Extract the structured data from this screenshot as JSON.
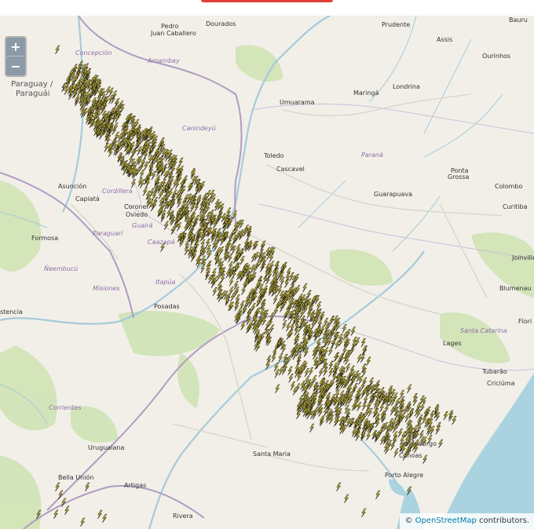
{
  "zoom": {
    "in_label": "+",
    "out_label": "−"
  },
  "attribution": {
    "prefix": "©",
    "link": "OpenStreetMap",
    "suffix": " contributors."
  },
  "colors": {
    "land": "#f2efe9",
    "water": "#aad3df",
    "forest": "#c8dfb0",
    "bolt": "#f5e33c",
    "bolt_outline": "#2d2a1a",
    "border": "#b09cc0"
  },
  "labels": [
    {
      "name": "label-pedro",
      "text": "Pedro",
      "cls": "city"
    },
    {
      "name": "label-dourados",
      "text": "Dourados",
      "cls": "city"
    },
    {
      "name": "label-juan-caballero",
      "text": "Juan Caballero",
      "cls": "city"
    },
    {
      "name": "label-prudente",
      "text": "Prudente",
      "cls": "city"
    },
    {
      "name": "label-bauru",
      "text": "Bauru",
      "cls": "city"
    },
    {
      "name": "label-concepcion",
      "text": "Concepción",
      "cls": "region"
    },
    {
      "name": "label-amambay",
      "text": "Amambay",
      "cls": "region"
    },
    {
      "name": "label-assis",
      "text": "Assis",
      "cls": "city"
    },
    {
      "name": "label-ourinhos",
      "text": "Ourinhos",
      "cls": "city"
    },
    {
      "name": "label-paraguay-1",
      "text": "Paraguay /",
      "cls": "country"
    },
    {
      "name": "label-paraguay-2",
      "text": "Paraguái",
      "cls": "country"
    },
    {
      "name": "label-maringa",
      "text": "Maringá",
      "cls": "city"
    },
    {
      "name": "label-londrina",
      "text": "Londrina",
      "cls": "city"
    },
    {
      "name": "label-umuarama",
      "text": "Umuarama",
      "cls": "city"
    },
    {
      "name": "label-canindeyu",
      "text": "Canindeyú",
      "cls": "region"
    },
    {
      "name": "label-toledo",
      "text": "Toledo",
      "cls": "city"
    },
    {
      "name": "label-parana",
      "text": "Paraná",
      "cls": "region"
    },
    {
      "name": "label-cascavel",
      "text": "Cascavel",
      "cls": "city"
    },
    {
      "name": "label-ponta-1",
      "text": "Ponta",
      "cls": "city"
    },
    {
      "name": "label-ponta-2",
      "text": "Grossa",
      "cls": "city"
    },
    {
      "name": "label-asuncion",
      "text": "Asunción",
      "cls": "city"
    },
    {
      "name": "label-capiata",
      "text": "Capiatá",
      "cls": "city"
    },
    {
      "name": "label-cordillera",
      "text": "Cordillera",
      "cls": "region"
    },
    {
      "name": "label-guarapuava",
      "text": "Guarapuava",
      "cls": "city"
    },
    {
      "name": "label-colombo",
      "text": "Colombo",
      "cls": "city"
    },
    {
      "name": "label-curitiba",
      "text": "Curitiba",
      "cls": "city"
    },
    {
      "name": "label-coronel-1",
      "text": "Coronel",
      "cls": "city"
    },
    {
      "name": "label-coronel-2",
      "text": "Oviedo",
      "cls": "city"
    },
    {
      "name": "label-guaira",
      "text": "Guairá",
      "cls": "region"
    },
    {
      "name": "label-formosa",
      "text": "Formosa",
      "cls": "city"
    },
    {
      "name": "label-paraguari",
      "text": "Paraguarí",
      "cls": "region"
    },
    {
      "name": "label-caazapa",
      "text": "Caazapá",
      "cls": "region"
    },
    {
      "name": "label-joinville",
      "text": "Joinville",
      "cls": "city"
    },
    {
      "name": "label-neembucu",
      "text": "Ñeembucú",
      "cls": "region"
    },
    {
      "name": "label-itapua",
      "text": "Itapúa",
      "cls": "region"
    },
    {
      "name": "label-blumenau",
      "text": "Blumenau",
      "cls": "city"
    },
    {
      "name": "label-misiones",
      "text": "Misiones",
      "cls": "region"
    },
    {
      "name": "label-posadas",
      "text": "Posadas",
      "cls": "city"
    },
    {
      "name": "label-stencia",
      "text": "stencia",
      "cls": "city"
    },
    {
      "name": "label-flori",
      "text": "Flori",
      "cls": "city"
    },
    {
      "name": "label-santa-catarina",
      "text": "Santa Catarina",
      "cls": "region"
    },
    {
      "name": "label-lages",
      "text": "Lages",
      "cls": "city"
    },
    {
      "name": "label-tubarao",
      "text": "Tubarão",
      "cls": "city"
    },
    {
      "name": "label-criciuma",
      "text": "Criciúma",
      "cls": "city"
    },
    {
      "name": "label-corrientes",
      "text": "Corrientes",
      "cls": "region"
    },
    {
      "name": "label-uruguaiana",
      "text": "Uruguaiana",
      "cls": "city"
    },
    {
      "name": "label-santa-maria",
      "text": "Santa Maria",
      "cls": "city"
    },
    {
      "name": "label-hamburgo",
      "text": "Hamburgo",
      "cls": "city"
    },
    {
      "name": "label-canoas",
      "text": "Canoas",
      "cls": "city"
    },
    {
      "name": "label-porto-alegre",
      "text": "Porto Alegre",
      "cls": "city"
    },
    {
      "name": "label-bella-union",
      "text": "Bella Unión",
      "cls": "city"
    },
    {
      "name": "label-artigas",
      "text": "Artigas",
      "cls": "city"
    },
    {
      "name": "label-rivera",
      "text": "Rivera",
      "cls": "city"
    }
  ]
}
